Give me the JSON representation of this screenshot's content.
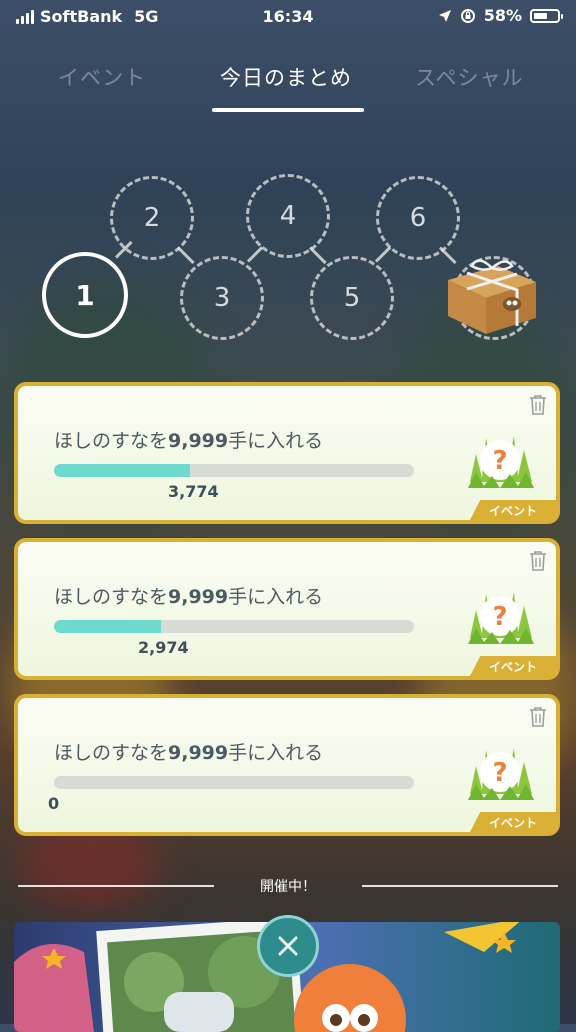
{
  "status_bar": {
    "carrier": "SoftBank",
    "network": "5G",
    "time": "16:34",
    "battery": "58%"
  },
  "tabs": [
    {
      "label": "イベント",
      "active": false
    },
    {
      "label": "今日のまとめ",
      "active": true
    },
    {
      "label": "スペシャル",
      "active": false
    }
  ],
  "steps": [
    "1",
    "2",
    "3",
    "4",
    "5",
    "6"
  ],
  "active_step": "1",
  "reward_icon": "gift-box-icon",
  "research_cards": [
    {
      "task_prefix": "ほしのすなを",
      "task_amount": "9,999",
      "task_suffix": "手に入れる",
      "progress_value": "3,774",
      "progress_fraction": 0.377,
      "tag": "イベント",
      "reward": "mystery-reward-icon"
    },
    {
      "task_prefix": "ほしのすなを",
      "task_amount": "9,999",
      "task_suffix": "手に入れる",
      "progress_value": "2,974",
      "progress_fraction": 0.297,
      "tag": "イベント",
      "reward": "mystery-reward-icon"
    },
    {
      "task_prefix": "ほしのすなを",
      "task_amount": "9,999",
      "task_suffix": "手に入れる",
      "progress_value": "0",
      "progress_fraction": 0,
      "tag": "イベント",
      "reward": "mystery-reward-icon"
    }
  ],
  "section_label": "開催中！",
  "colors": {
    "card_border": "#d9b034",
    "progress_fill": "#6dd9cf",
    "close_button": "#2e8b8c"
  }
}
